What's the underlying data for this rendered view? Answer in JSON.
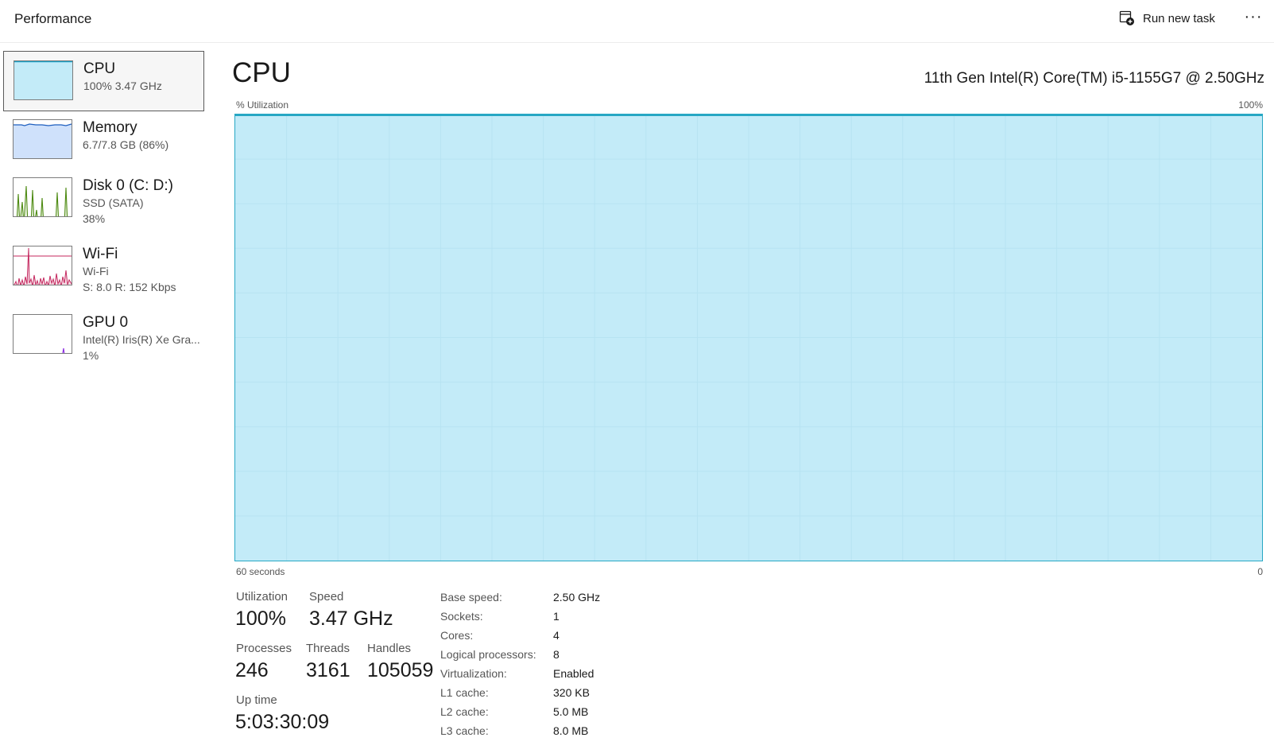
{
  "header": {
    "title": "Performance",
    "run_new_task_label": "Run new task",
    "more_label": "···"
  },
  "sidebar": {
    "items": [
      {
        "name": "CPU",
        "line1": "100%  3.47 GHz",
        "line2": "",
        "color": "#17a1c6",
        "fill": "#c3ebf8"
      },
      {
        "name": "Memory",
        "line1": "6.7/7.8 GB (86%)",
        "line2": "",
        "color": "#1f5fbf",
        "fill": "#cfe1fb"
      },
      {
        "name": "Disk 0 (C: D:)",
        "line1": "SSD (SATA)",
        "line2": "38%",
        "color": "#4d8a12",
        "fill": "#eef6e4"
      },
      {
        "name": "Wi-Fi",
        "line1": "Wi-Fi",
        "line2": "S: 8.0  R: 152 Kbps",
        "color": "#c4275e",
        "fill": "#f7dbe5"
      },
      {
        "name": "GPU 0",
        "line1": "Intel(R) Iris(R) Xe Gra...",
        "line2": "1%",
        "color": "#8a2be2",
        "fill": "#ffffff"
      }
    ]
  },
  "main": {
    "title": "CPU",
    "model": "11th Gen Intel(R) Core(TM) i5-1155G7 @ 2.50GHz",
    "graph": {
      "y_label": "% Utilization",
      "y_max_label": "100%",
      "x_left_label": "60 seconds",
      "x_right_label": "0",
      "utilization_percent": 100,
      "line_color": "#27a7c4",
      "fill_color": "#c3ebf8"
    },
    "stats": {
      "utilization_label": "Utilization",
      "utilization_value": "100%",
      "speed_label": "Speed",
      "speed_value": "3.47 GHz",
      "processes_label": "Processes",
      "processes_value": "246",
      "threads_label": "Threads",
      "threads_value": "3161",
      "handles_label": "Handles",
      "handles_value": "105059",
      "uptime_label": "Up time",
      "uptime_value": "5:03:30:09"
    },
    "specs": [
      {
        "key": "Base speed:",
        "value": "2.50 GHz"
      },
      {
        "key": "Sockets:",
        "value": "1"
      },
      {
        "key": "Cores:",
        "value": "4"
      },
      {
        "key": "Logical processors:",
        "value": "8"
      },
      {
        "key": "Virtualization:",
        "value": "Enabled"
      },
      {
        "key": "L1 cache:",
        "value": "320 KB"
      },
      {
        "key": "L2 cache:",
        "value": "5.0 MB"
      },
      {
        "key": "L3 cache:",
        "value": "8.0 MB"
      }
    ]
  }
}
